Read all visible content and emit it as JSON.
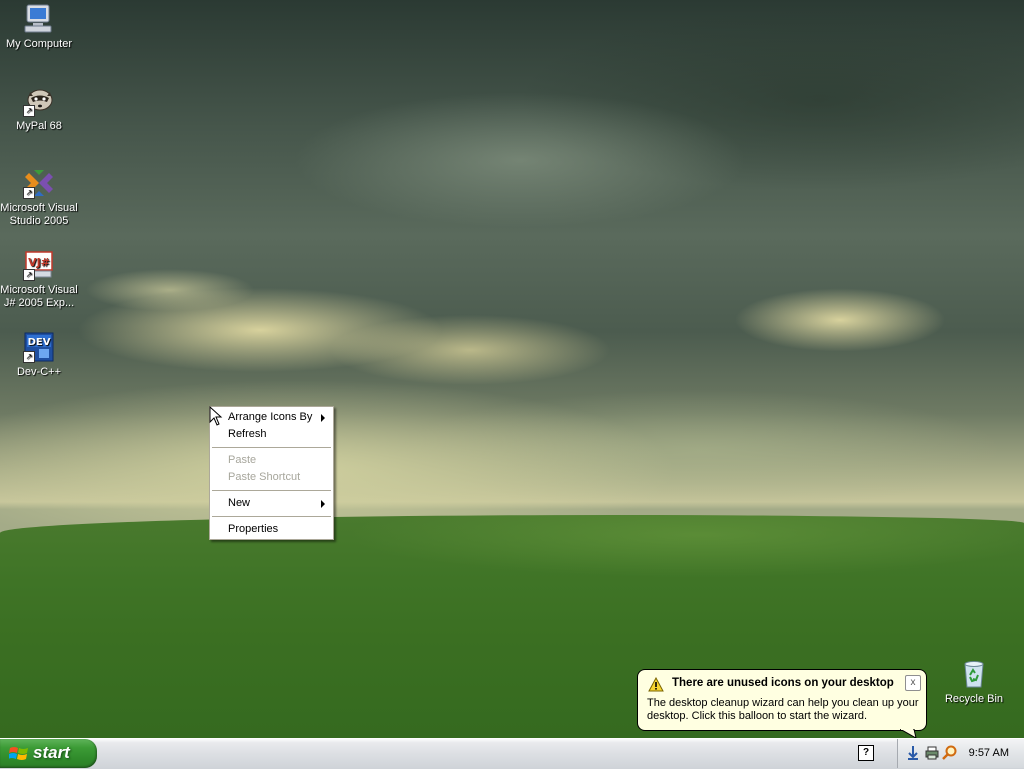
{
  "desktop": {
    "icons": [
      {
        "label": "My Computer",
        "icon": "computer-icon"
      },
      {
        "label": "MyPal 68",
        "icon": "mypal-raccoon-icon"
      },
      {
        "label": "Microsoft Visual Studio 2005",
        "icon": "visual-studio-icon"
      },
      {
        "label": "Microsoft Visual J# 2005 Exp...",
        "icon": "visual-jsharp-icon"
      },
      {
        "label": "Dev-C++",
        "icon": "dev-cpp-icon",
        "badge_text": "DEV"
      },
      {
        "label": "Recycle Bin",
        "icon": "recycle-bin-icon"
      }
    ]
  },
  "context_menu": {
    "items": [
      {
        "label": "Arrange Icons By",
        "submenu": true,
        "enabled": true
      },
      {
        "label": "Refresh",
        "submenu": false,
        "enabled": true
      },
      {
        "label": "Paste",
        "submenu": false,
        "enabled": false
      },
      {
        "label": "Paste Shortcut",
        "submenu": false,
        "enabled": false
      },
      {
        "label": "New",
        "submenu": true,
        "enabled": true
      },
      {
        "label": "Properties",
        "submenu": false,
        "enabled": true
      }
    ]
  },
  "balloon": {
    "title": "There are unused icons on your desktop",
    "body": "The desktop cleanup wizard can help you clean up your desktop. Click this balloon to start the wizard.",
    "close_label": "x",
    "icon": "warning-icon"
  },
  "taskbar": {
    "start_label": "start",
    "help_label": "?",
    "clock": "9:57 AM",
    "tray_icons": [
      "network-icon",
      "printer-icon",
      "search-icon"
    ]
  },
  "colors": {
    "balloon_bg": "#ffffe1",
    "start_green": "#3c9b36",
    "menu_disabled": "#a7a69c"
  }
}
